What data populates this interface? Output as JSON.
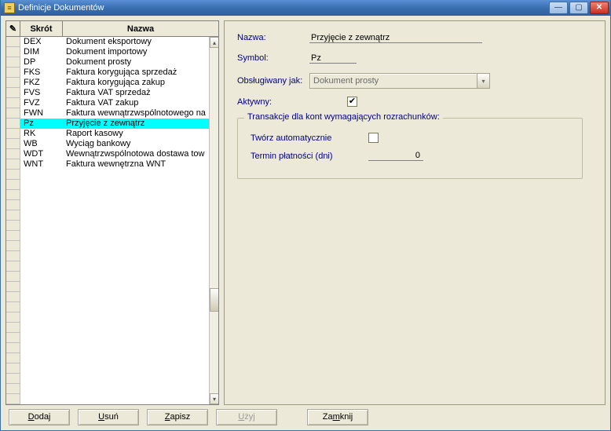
{
  "window": {
    "title": "Definicje Dokumentów"
  },
  "grid": {
    "check_header_glyph": "✎",
    "skrot_header": "Skrót",
    "nazwa_header": "Nazwa",
    "selected_index": 8,
    "rows": [
      {
        "skrot": "DEX",
        "nazwa": "Dokument eksportowy"
      },
      {
        "skrot": "DIM",
        "nazwa": "Dokument importowy"
      },
      {
        "skrot": "DP",
        "nazwa": "Dokument prosty"
      },
      {
        "skrot": "FKS",
        "nazwa": "Faktura korygująca sprzedaż"
      },
      {
        "skrot": "FKZ",
        "nazwa": "Faktura korygująca zakup"
      },
      {
        "skrot": "FVS",
        "nazwa": "Faktura VAT sprzedaż"
      },
      {
        "skrot": "FVZ",
        "nazwa": "Faktura VAT zakup"
      },
      {
        "skrot": "FWN",
        "nazwa": "Faktura wewnątrzwspólnotowego na"
      },
      {
        "skrot": "Pz",
        "nazwa": "Przyjęcie z zewnątrz"
      },
      {
        "skrot": "RK",
        "nazwa": "Raport kasowy"
      },
      {
        "skrot": "WB",
        "nazwa": "Wyciąg bankowy"
      },
      {
        "skrot": "WDT",
        "nazwa": "Wewnątrzwspólnotowa dostawa tow"
      },
      {
        "skrot": "WNT",
        "nazwa": "Faktura wewnętrzna WNT"
      }
    ]
  },
  "form": {
    "nazwa_label": "Nazwa:",
    "nazwa_value": "Przyjęcie z zewnątrz",
    "symbol_label": "Symbol:",
    "symbol_value": "Pz",
    "obslugiwany_label": "Obsługiwany jak:",
    "obslugiwany_value": "Dokument prosty",
    "aktywny_label": "Aktywny:",
    "aktywny_checked": true,
    "groupbox_legend": "Transakcje dla kont wymagających rozrachunków:",
    "tworz_label": "Twórz automatycznie",
    "tworz_checked": false,
    "termin_label": "Termin płatności (dni)",
    "termin_value": "0"
  },
  "buttons": {
    "dodaj": "Dodaj",
    "usun": "Usuń",
    "zapisz": "Zapisz",
    "uzyj": "Użyj",
    "zamknij": "Zamknij"
  },
  "glyphs": {
    "check": "✔",
    "triangle_down": "▾",
    "triangle_up": "▴",
    "close": "✕",
    "minimize": "—",
    "maximize": "▢"
  }
}
